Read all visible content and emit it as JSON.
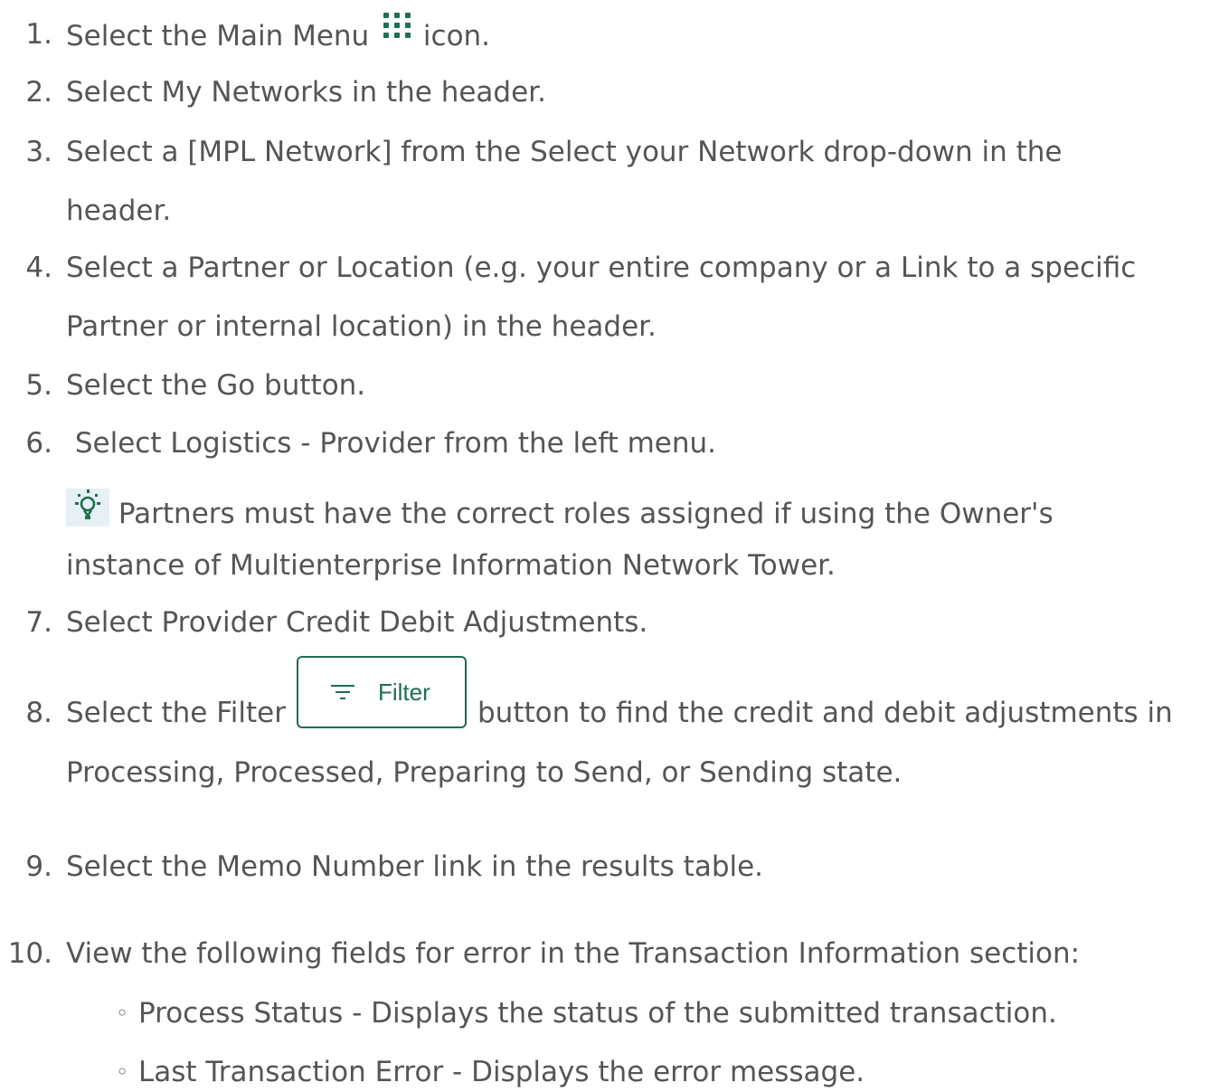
{
  "steps": [
    {
      "num": "1.",
      "text_a": "Select the Main Menu",
      "text_b": "icon."
    },
    {
      "num": "2.",
      "text": "Select My Networks in the header."
    },
    {
      "num": "3.",
      "line1": "Select a [MPL Network] from the Select your Network drop-down in the",
      "line2": "header."
    },
    {
      "num": "4.",
      "line1": "Select a Partner or Location (e.g. your entire company or a Link to a specific",
      "line2": "Partner or internal location) in the header."
    },
    {
      "num": "5.",
      "text": "Select the Go button."
    },
    {
      "num": "6.",
      "text": " Select Logistics - Provider from the left menu.",
      "tip_line1": "Partners must have the correct roles assigned if using the Owner's",
      "tip_line2": "instance of Multienterprise Information Network Tower."
    },
    {
      "num": "7.",
      "text": "Select Provider Credit Debit Adjustments."
    },
    {
      "num": "8.",
      "text_a": "Select the Filter",
      "button_label": "Filter",
      "text_b": "button to find the credit and debit adjustments in",
      "line2": "Processing, Processed, Preparing to Send, or Sending state."
    },
    {
      "num": "9.",
      "text": "Select the Memo Number link in the results table."
    },
    {
      "num": "10.",
      "text": "View the following fields for error in the Transaction Information section:",
      "sub_items": [
        "Process Status - Displays the status of the submitted transaction.",
        "Last Transaction Error - Displays the error message."
      ]
    }
  ],
  "icons": {
    "main_menu": "grid-dots-icon",
    "tip": "lightbulb-icon",
    "filter": "filter-lines-icon"
  },
  "colors": {
    "text": "#555555",
    "accent": "#1f6e50",
    "tip_bg": "#e6f0f6"
  }
}
